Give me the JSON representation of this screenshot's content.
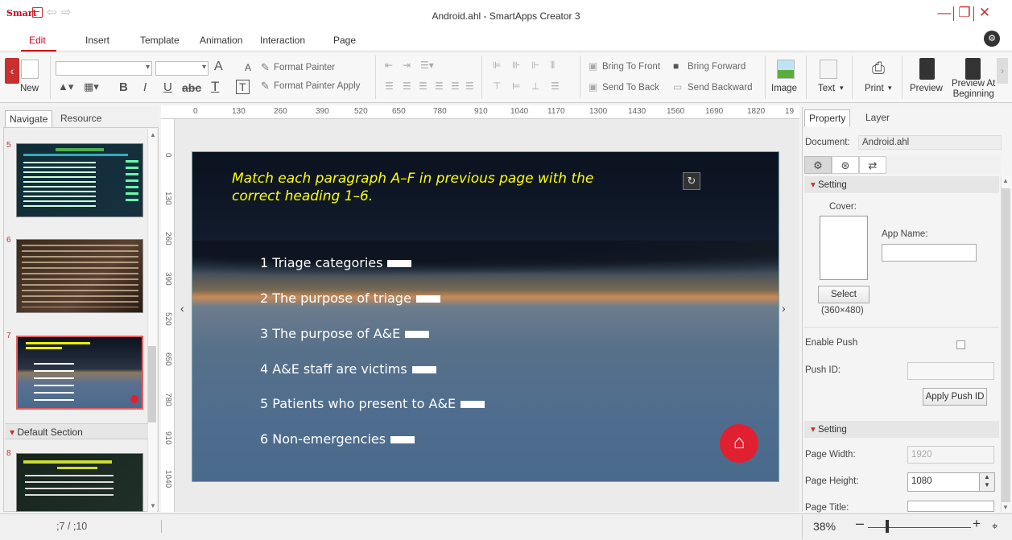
{
  "app": {
    "logo": "Smart",
    "title": "Android.ahl - SmartApps Creator 3",
    "win_minimize": "—",
    "win_restore": "❐",
    "win_close": "✕"
  },
  "menu": [
    "Edit",
    "Insert",
    "Template",
    "Animation",
    "Interaction",
    "Page"
  ],
  "ribbon": {
    "new": "New",
    "font_size_up": "A",
    "font_size_down": "A",
    "format_painter": "Format Painter",
    "format_painter_apply": "Format Painter Apply",
    "bold": "B",
    "italic": "I",
    "underline": "U",
    "strikethrough": "abc",
    "text_color": "T",
    "text_box": "T",
    "bring_to_front": "Bring To Front",
    "bring_forward": "Bring Forward",
    "send_to_back": "Send To Back",
    "send_backward": "Send Backward",
    "image": "Image",
    "text": "Text",
    "print": "Print",
    "preview": "Preview",
    "preview_at_beginning_1": "Preview At",
    "preview_at_beginning_2": "Beginning"
  },
  "navigator": {
    "tabs": [
      "Navigate",
      "Resource"
    ],
    "pages": [
      "5",
      "6",
      "7",
      "8"
    ],
    "section": "Default Section"
  },
  "ruler": {
    "h": [
      "0",
      "130",
      "260",
      "390",
      "520",
      "650",
      "780",
      "910",
      "1040",
      "1170",
      "1300",
      "1430",
      "1560",
      "1690",
      "1820",
      "19"
    ],
    "v": [
      "0",
      "130",
      "260",
      "390",
      "520",
      "650",
      "780",
      "910",
      "1040"
    ]
  },
  "slide": {
    "title": "Match each paragraph A–F in previous page with the correct heading 1–6.",
    "headings": [
      "1 Triage categories",
      "2 The purpose of triage",
      "3 The purpose of A&E",
      "4 A&E staff are victims",
      "5 Patients who present to A&E",
      "6 Non-emergencies"
    ]
  },
  "property": {
    "tabs": [
      "Property",
      "Layer"
    ],
    "document_label": "Document:",
    "document_value": "Android.ahl",
    "setting1": "Setting",
    "cover_label": "Cover:",
    "app_name_label": "App Name:",
    "select_button": "Select",
    "cover_size": "(360×480)",
    "enable_push_label": "Enable Push",
    "push_id_label": "Push ID:",
    "apply_push_button": "Apply Push ID",
    "setting2": "Setting",
    "page_width_label": "Page Width:",
    "page_width_value": "1920",
    "page_height_label": "Page Height:",
    "page_height_value": "1080",
    "page_title_label": "Page Title:"
  },
  "status": {
    "page": ";7  /  ;10",
    "zoom": "38%"
  }
}
